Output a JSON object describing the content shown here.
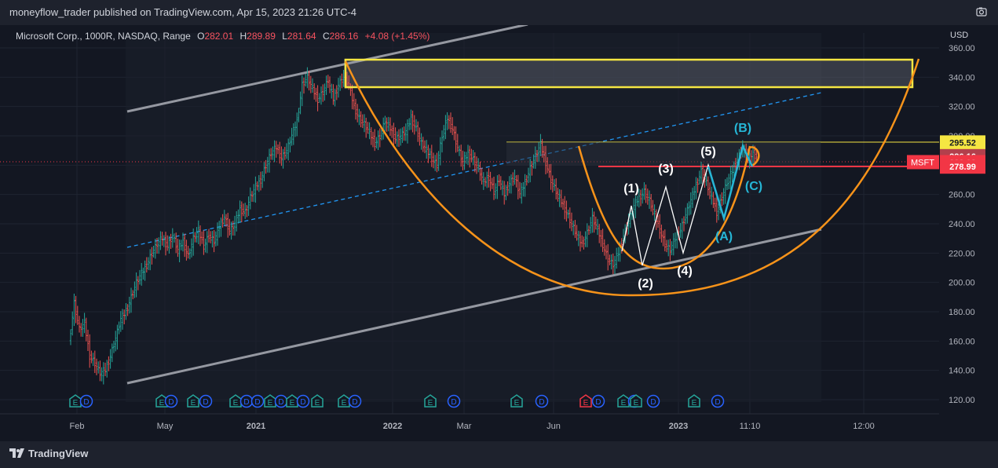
{
  "header": {
    "publish_text": "moneyflow_trader published on TradingView.com, Apr 15, 2023 21:26 UTC-4"
  },
  "symbol_info": {
    "name": "Microsoft Corp., 1000R, NASDAQ, Range",
    "open_label": "O",
    "open": "282.01",
    "high_label": "H",
    "high": "289.89",
    "low_label": "L",
    "low": "281.64",
    "close_label": "C",
    "close": "286.16",
    "change": "+4.08 (+1.45%)"
  },
  "footer": {
    "brand": "TradingView"
  },
  "colors": {
    "background": "#131722",
    "up": "#26a69a",
    "down": "#ef5350",
    "orange": "#f7931a",
    "yellow": "#f5e642",
    "cyan": "#26b6d6",
    "channel": "#9598a1",
    "dashed": "#2196f3",
    "red_line": "#f23645"
  },
  "chart_data": {
    "type": "candlestick",
    "currency_label": "USD",
    "y_ticks": [
      "360.00",
      "340.00",
      "320.00",
      "300.00",
      "280.00",
      "260.00",
      "240.00",
      "220.00",
      "200.00",
      "180.00",
      "160.00",
      "140.00",
      "120.00"
    ],
    "x_ticks": [
      "Feb",
      "May",
      "2021",
      "2022",
      "Mar",
      "Jun",
      "2023",
      "11:10",
      "12:00"
    ],
    "ylim": [
      110,
      366
    ],
    "price_labels": [
      {
        "text": "295.52",
        "value": 295.52,
        "bg": "#f5e642",
        "fg": "#131722"
      },
      {
        "text": "286.16",
        "value": 286.16,
        "bg": "#b2404c",
        "fg": "#ffffff"
      },
      {
        "text": "282.08",
        "value": 282.08,
        "bg": "#f23645",
        "fg": "#ffffff",
        "tag": "MSFT"
      },
      {
        "text": "278.99",
        "value": 278.99,
        "bg": "#f23645",
        "fg": "#ffffff"
      }
    ],
    "wave_labels": [
      {
        "text": "(1)",
        "color": "#ffffff"
      },
      {
        "text": "(2)",
        "color": "#ffffff"
      },
      {
        "text": "(3)",
        "color": "#ffffff"
      },
      {
        "text": "(4)",
        "color": "#ffffff"
      },
      {
        "text": "(5)",
        "color": "#ffffff"
      },
      {
        "text": "(A)",
        "color": "#26b6d6"
      },
      {
        "text": "(B)",
        "color": "#26b6d6"
      },
      {
        "text": "(C)",
        "color": "#26b6d6"
      }
    ],
    "events": [
      {
        "kind": "E"
      },
      {
        "kind": "D"
      },
      {
        "kind": "E"
      },
      {
        "kind": "D"
      },
      {
        "kind": "E"
      },
      {
        "kind": "D"
      },
      {
        "kind": "E"
      },
      {
        "kind": "D"
      },
      {
        "kind": "D"
      },
      {
        "kind": "E"
      },
      {
        "kind": "D"
      },
      {
        "kind": "E"
      },
      {
        "kind": "D"
      },
      {
        "kind": "E"
      },
      {
        "kind": "E"
      },
      {
        "kind": "D"
      },
      {
        "kind": "E"
      },
      {
        "kind": "D"
      },
      {
        "kind": "E"
      },
      {
        "kind": "D"
      },
      {
        "kind": "E"
      },
      {
        "kind": "D"
      },
      {
        "kind": "E-red"
      },
      {
        "kind": "D"
      },
      {
        "kind": "E"
      },
      {
        "kind": "D"
      },
      {
        "kind": "E"
      },
      {
        "kind": "D"
      }
    ],
    "price_series": [
      {
        "seg": 1,
        "points": [
          [
            0,
            158
          ],
          [
            3,
            186
          ],
          [
            6,
            168
          ],
          [
            9,
            172
          ],
          [
            12,
            150
          ],
          [
            15,
            145
          ],
          [
            18,
            138
          ],
          [
            21,
            140
          ],
          [
            24,
            150
          ],
          [
            27,
            162
          ],
          [
            30,
            175
          ],
          [
            33,
            180
          ],
          [
            36,
            190
          ],
          [
            39,
            200
          ],
          [
            42,
            206
          ],
          [
            45,
            212
          ],
          [
            48,
            220
          ],
          [
            51,
            226
          ],
          [
            54,
            230
          ],
          [
            57,
            225
          ],
          [
            60,
            232
          ],
          [
            63,
            222
          ],
          [
            66,
            228
          ],
          [
            69,
            218
          ],
          [
            72,
            230
          ],
          [
            75,
            235
          ],
          [
            78,
            225
          ],
          [
            81,
            232
          ],
          [
            84,
            228
          ],
          [
            87,
            238
          ],
          [
            90,
            245
          ],
          [
            93,
            235
          ],
          [
            96,
            240
          ],
          [
            99,
            250
          ],
          [
            102,
            248
          ],
          [
            105,
            258
          ],
          [
            108,
            265
          ],
          [
            111,
            270
          ],
          [
            114,
            280
          ],
          [
            117,
            288
          ],
          [
            120,
            292
          ],
          [
            123,
            285
          ],
          [
            126,
            290
          ],
          [
            129,
            300
          ],
          [
            132,
            310
          ],
          [
            135,
            335
          ],
          [
            138,
            340
          ],
          [
            141,
            332
          ],
          [
            144,
            325
          ],
          [
            147,
            330
          ],
          [
            150,
            338
          ],
          [
            153,
            325
          ],
          [
            156,
            335
          ],
          [
            159,
            340
          ],
          [
            162,
            335
          ],
          [
            165,
            320
          ],
          [
            168,
            312
          ],
          [
            171,
            308
          ],
          [
            174,
            302
          ],
          [
            177,
            295
          ],
          [
            180,
            300
          ],
          [
            183,
            310
          ],
          [
            186,
            305
          ],
          [
            189,
            298
          ],
          [
            192,
            300
          ],
          [
            195,
            303
          ],
          [
            198,
            312
          ],
          [
            201,
            305
          ],
          [
            204,
            295
          ],
          [
            207,
            290
          ],
          [
            210,
            285
          ],
          [
            213,
            280
          ],
          [
            216,
            300
          ],
          [
            219,
            312
          ],
          [
            222,
            305
          ],
          [
            225,
            292
          ],
          [
            228,
            282
          ],
          [
            231,
            288
          ],
          [
            234,
            284
          ],
          [
            237,
            278
          ],
          [
            240,
            268
          ],
          [
            243,
            272
          ],
          [
            246,
            262
          ],
          [
            249,
            270
          ],
          [
            252,
            260
          ],
          [
            255,
            268
          ],
          [
            258,
            272
          ],
          [
            261,
            260
          ],
          [
            264,
            268
          ],
          [
            267,
            278
          ],
          [
            270,
            286
          ],
          [
            273,
            294
          ],
          [
            276,
            282
          ],
          [
            279,
            270
          ],
          [
            282,
            262
          ],
          [
            285,
            255
          ],
          [
            288,
            248
          ],
          [
            291,
            240
          ],
          [
            294,
            232
          ],
          [
            297,
            226
          ],
          [
            300,
            234
          ],
          [
            303,
            244
          ],
          [
            306,
            236
          ],
          [
            309,
            226
          ],
          [
            312,
            216
          ],
          [
            315,
            212
          ],
          [
            318,
            220
          ],
          [
            321,
            232
          ],
          [
            324,
            242
          ],
          [
            327,
            252
          ],
          [
            330,
            258
          ],
          [
            333,
            262
          ],
          [
            336,
            256
          ],
          [
            339,
            246
          ],
          [
            342,
            236
          ],
          [
            345,
            226
          ],
          [
            348,
            222
          ],
          [
            351,
            230
          ],
          [
            354,
            236
          ],
          [
            357,
            246
          ],
          [
            360,
            256
          ],
          [
            363,
            266
          ],
          [
            366,
            276
          ],
          [
            369,
            268
          ],
          [
            372,
            258
          ],
          [
            375,
            248
          ],
          [
            378,
            258
          ],
          [
            381,
            268
          ],
          [
            384,
            276
          ],
          [
            387,
            284
          ],
          [
            390,
            292
          ],
          [
            393,
            284
          ],
          [
            396,
            288
          ],
          [
            398,
            286
          ]
        ]
      }
    ]
  }
}
